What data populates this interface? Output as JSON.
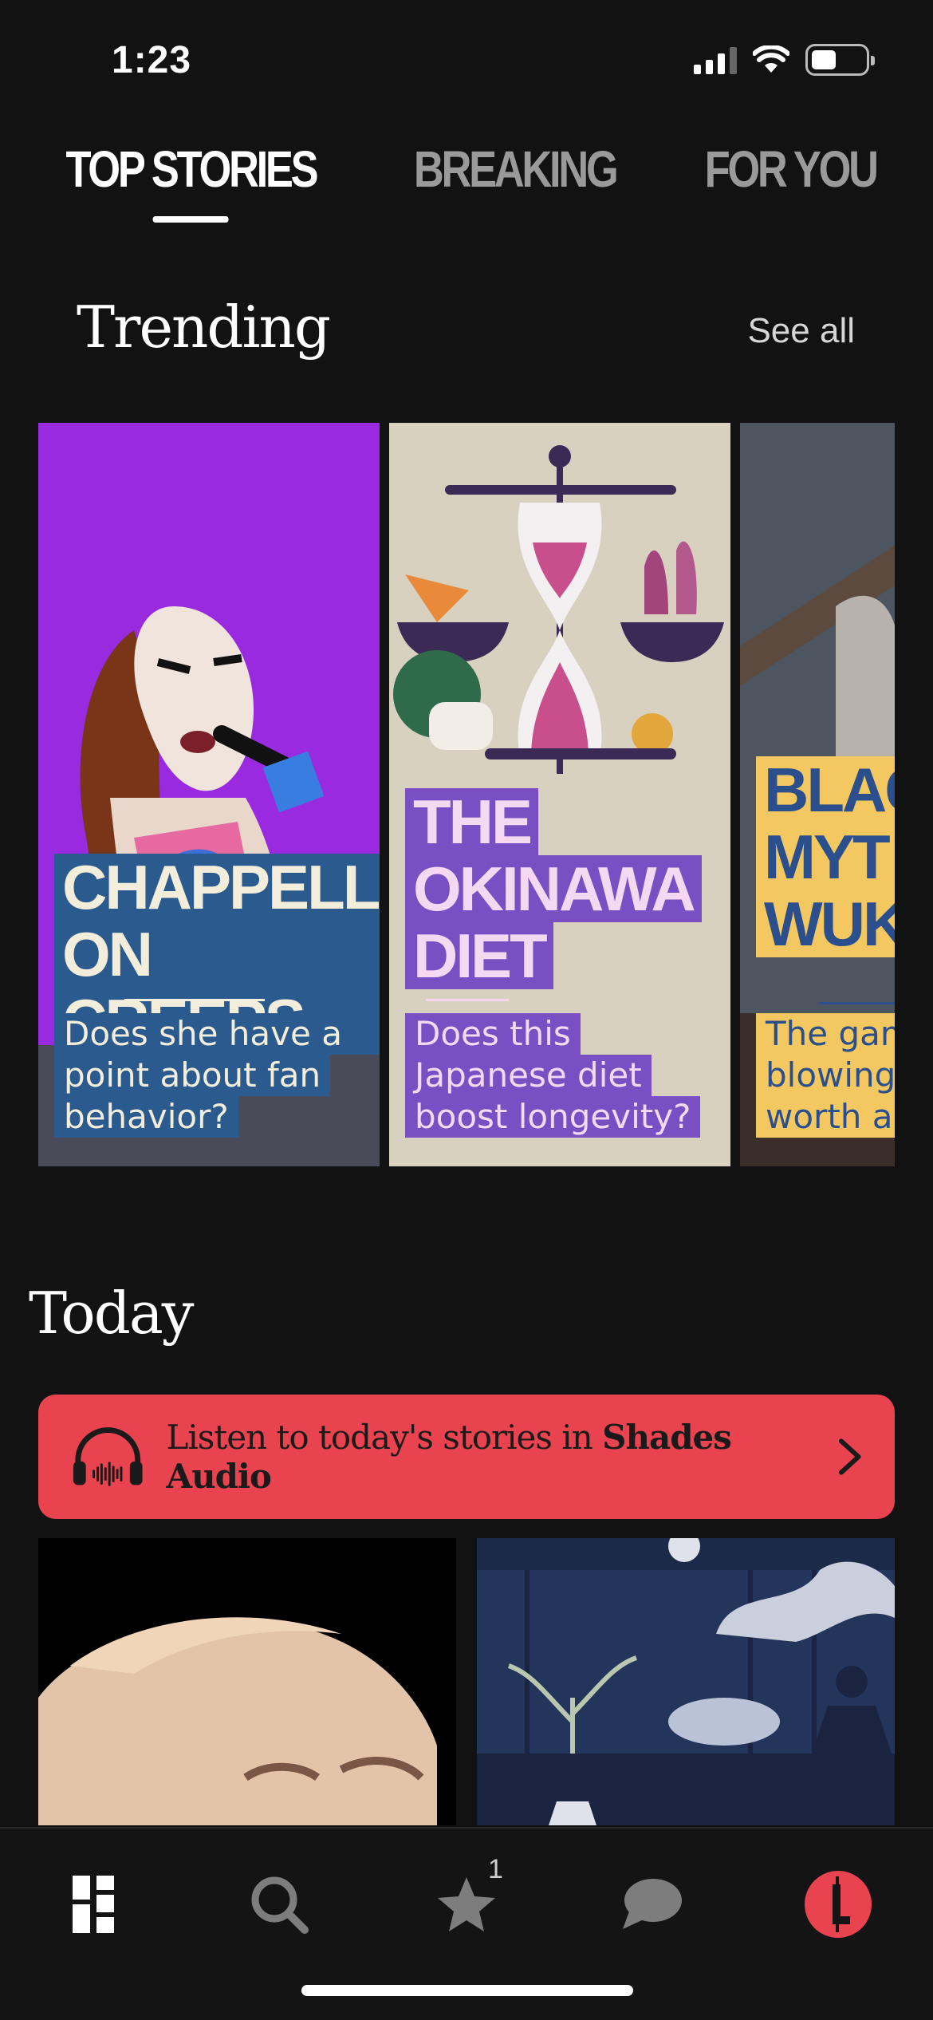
{
  "status_bar": {
    "time": "1:23",
    "battery_level": 0.4
  },
  "top_tabs": [
    {
      "label": "TOP STORIES",
      "active": true
    },
    {
      "label": "BREAKING",
      "active": false
    },
    {
      "label": "FOR YOU",
      "active": false
    }
  ],
  "trending": {
    "title": "Trending",
    "see_all": "See all",
    "cards": [
      {
        "headline_1": "CHAPPELL",
        "headline_2": "ON CREEPS",
        "sub_1": "Does she have a",
        "sub_2": "point about fan",
        "sub_3": "behavior?",
        "bg_color": "#9a2ae0",
        "label_bg": "#2b5a8f",
        "label_fg": "#f3eedc"
      },
      {
        "headline_1": "THE",
        "headline_2": "OKINAWA",
        "headline_3": "DIET",
        "sub_1": "Does this",
        "sub_2": "Japanese diet",
        "sub_3": "boost longevity?",
        "bg_color": "#d8d1c0",
        "label_bg": "#7a4fc4",
        "label_fg": "#f6d8f2"
      },
      {
        "headline_1": "BLAC",
        "headline_2": "MYT",
        "headline_3": "WUK",
        "sub_1": "The gam",
        "sub_2": "blowing",
        "sub_3": "worth a",
        "bg_color": "#4c5560",
        "label_bg": "#f4c860",
        "label_fg": "#2a4f8c"
      }
    ]
  },
  "today": {
    "title": "Today",
    "audio_banner": {
      "text_prefix": "Listen to today's stories in ",
      "text_brand": "Shades Audio"
    }
  },
  "bottom_nav": {
    "items": [
      {
        "name": "home",
        "icon": "grid-home-icon"
      },
      {
        "name": "search",
        "icon": "search-icon"
      },
      {
        "name": "favorites",
        "icon": "star-icon"
      },
      {
        "name": "messages",
        "icon": "chat-bubble-icon"
      },
      {
        "name": "profile",
        "icon": "profile-logo-icon"
      }
    ],
    "favorites_badge": "1"
  },
  "colors": {
    "background": "#121212",
    "audio_banner": "#e8434f",
    "profile_logo": "#e8434f"
  }
}
